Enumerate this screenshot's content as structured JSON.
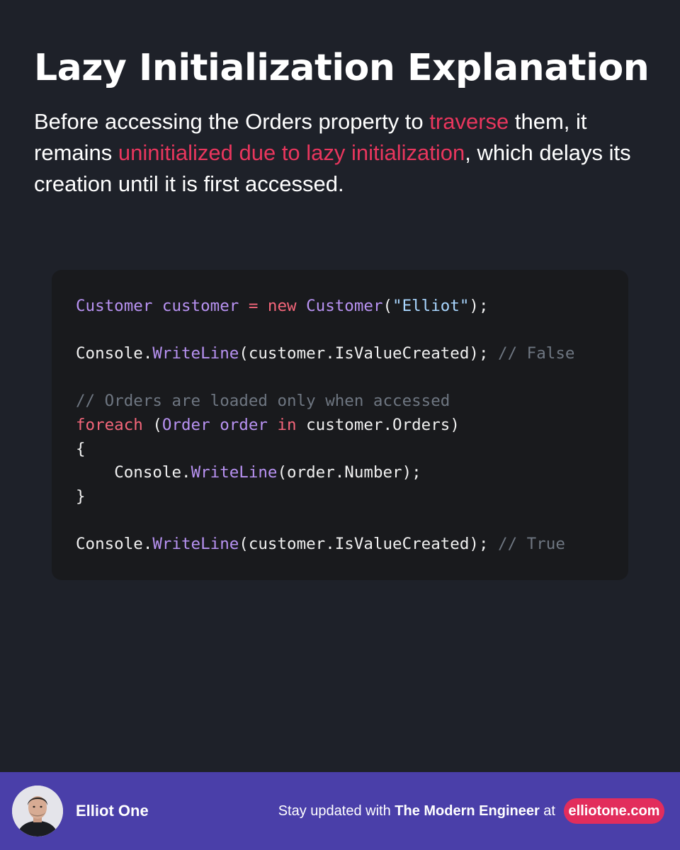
{
  "title": "Lazy Initialization Explanation",
  "intro": {
    "part1": "Before accessing the Orders property to ",
    "highlight1": "traverse",
    "part2": " them, it remains ",
    "highlight2": "uninitialized due to lazy initialization",
    "part3": ", which delays its creation until it is first accessed."
  },
  "code": {
    "line1": {
      "type1": "Customer",
      "var1": " customer ",
      "eq": "=",
      "kw_new": " new ",
      "type2": "Customer",
      "open": "(",
      "str": "\"Elliot\"",
      "close": ");"
    },
    "line3": {
      "obj": "Console.",
      "method": "WriteLine",
      "args": "(customer.IsValueCreated); ",
      "comment": "// False"
    },
    "line5": {
      "comment": "// Orders are loaded only when accessed"
    },
    "line6": {
      "kw_foreach": "foreach",
      "open": " (",
      "type": "Order",
      "var": " order ",
      "kw_in": "in",
      "rest": " customer.Orders)"
    },
    "line7": "{",
    "line8": {
      "indent": "    ",
      "obj": "Console.",
      "method": "WriteLine",
      "args": "(order.Number);"
    },
    "line9": "}",
    "line11": {
      "obj": "Console.",
      "method": "WriteLine",
      "args": "(customer.IsValueCreated); ",
      "comment": "// True"
    }
  },
  "footer": {
    "author": "Elliot One",
    "tagline_prefix": "Stay updated with ",
    "tagline_brand": "The Modern Engineer",
    "tagline_suffix": " at",
    "site": "elliotone.com"
  },
  "colors": {
    "background": "#1e2129",
    "code_panel": "#191a1d",
    "highlight": "#e8365d",
    "footer": "#4a3fa9",
    "pill": "#e22d5c",
    "syntax_type": "#b892f2",
    "syntax_keyword": "#f4667a",
    "syntax_string": "#a9d6ff",
    "syntax_comment": "#6e7681"
  },
  "icons": {
    "avatar": "author-portrait"
  }
}
